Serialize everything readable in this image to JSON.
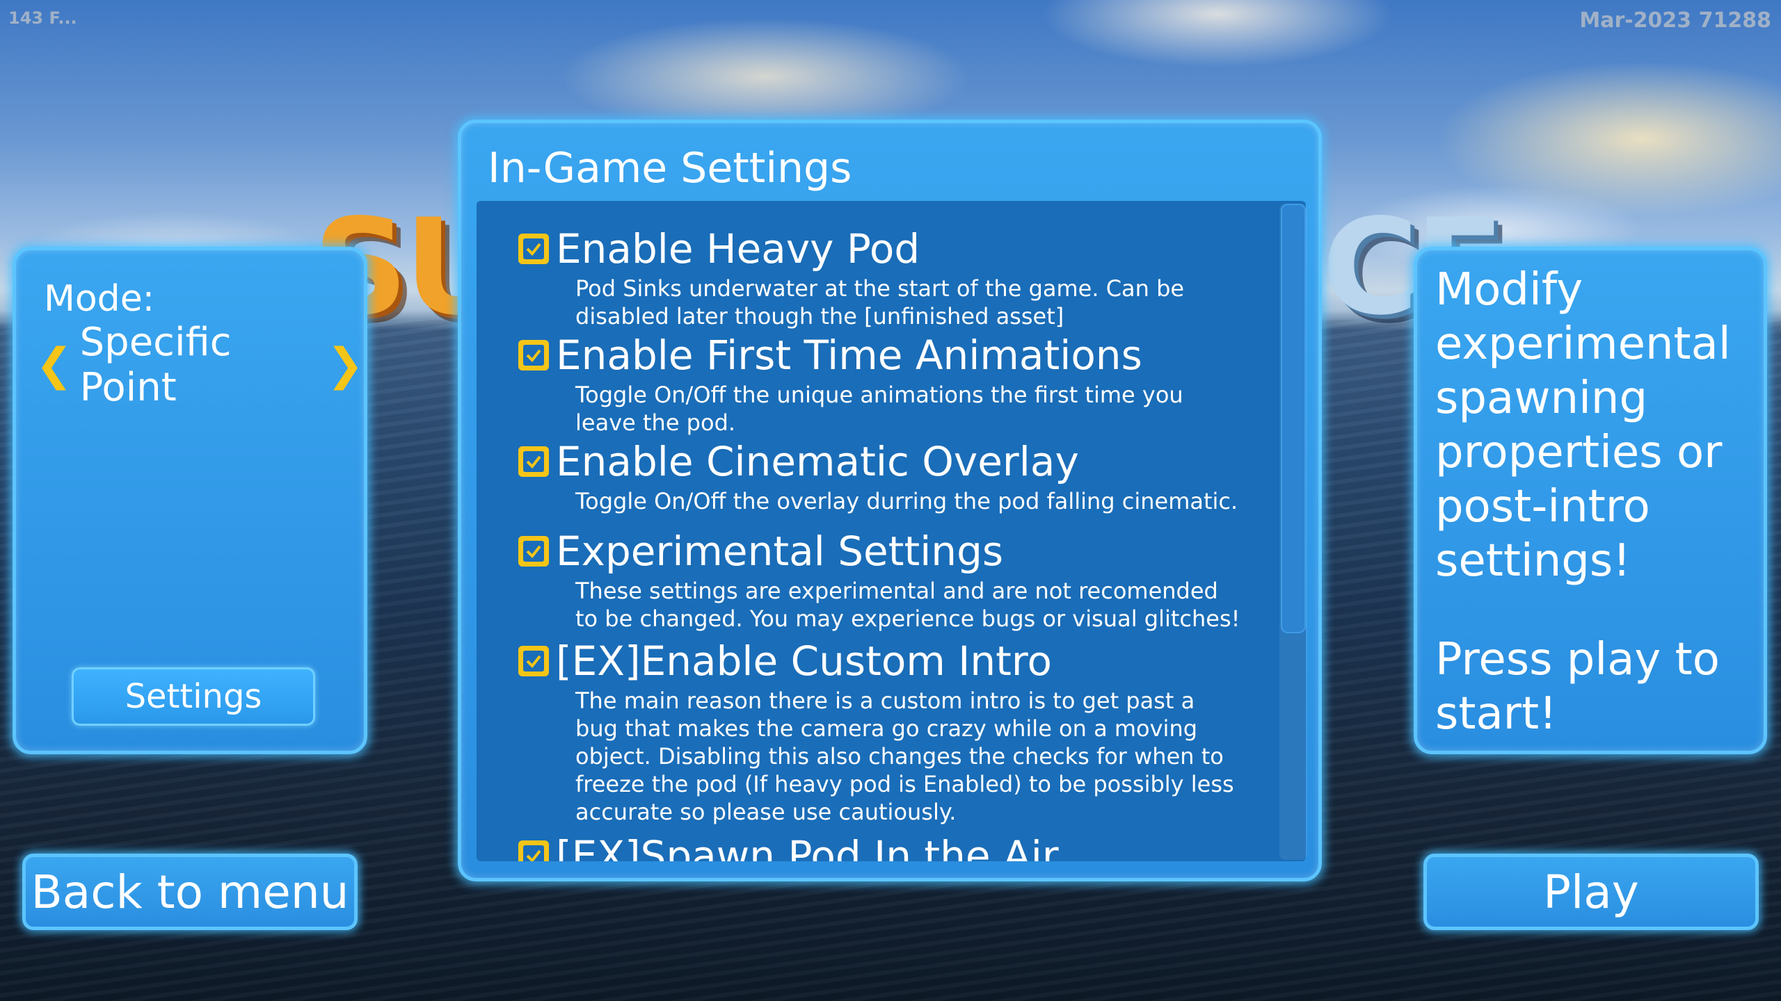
{
  "hud": {
    "fps": "143 F...",
    "build": "Mar-2023 71288"
  },
  "background_logo": {
    "left_fragment": "SU",
    "right_fragment": "CE"
  },
  "mode_panel": {
    "label": "Mode:",
    "value": "Specific Point",
    "prev_arrow": "❮",
    "next_arrow": "❯",
    "settings_button": "Settings"
  },
  "settings": {
    "title": "In-Game Settings",
    "options": [
      {
        "label": "Enable Heavy Pod",
        "checked": true,
        "description": "Pod Sinks underwater at the start of the game. Can be disabled later though the [unfinished asset]"
      },
      {
        "label": "Enable First Time Animations",
        "checked": true,
        "description": "Toggle On/Off the unique animations the first time you leave the pod."
      },
      {
        "label": "Enable Cinematic Overlay",
        "checked": true,
        "description": "Toggle On/Off the overlay durring the pod falling cinematic."
      },
      {
        "label": "Experimental Settings",
        "checked": true,
        "description": "These settings are experimental and are not recomended to be changed. You may experience bugs or visual glitches!"
      },
      {
        "label": "[EX]Enable Custom Intro",
        "checked": true,
        "description": "The main reason there is a custom intro is to get past a bug that makes the camera go crazy while on a moving object. Disabling this also changes the checks for when to freeze the pod (If heavy pod is Enabled) to be possibly less accurate so please use cautiously."
      },
      {
        "label": "[EX]Spawn Pod In the Air",
        "checked": true,
        "description": ""
      }
    ]
  },
  "info": {
    "text": "Modify experimental spawning properties or post-intro settings!",
    "text2": "Press play to start!"
  },
  "buttons": {
    "back": "Back to menu",
    "play": "Play"
  },
  "colors": {
    "panel": "#2a8ee0",
    "panel_border": "#5cc4ff",
    "inner": "#1a6db8",
    "check": "#f5c518"
  }
}
